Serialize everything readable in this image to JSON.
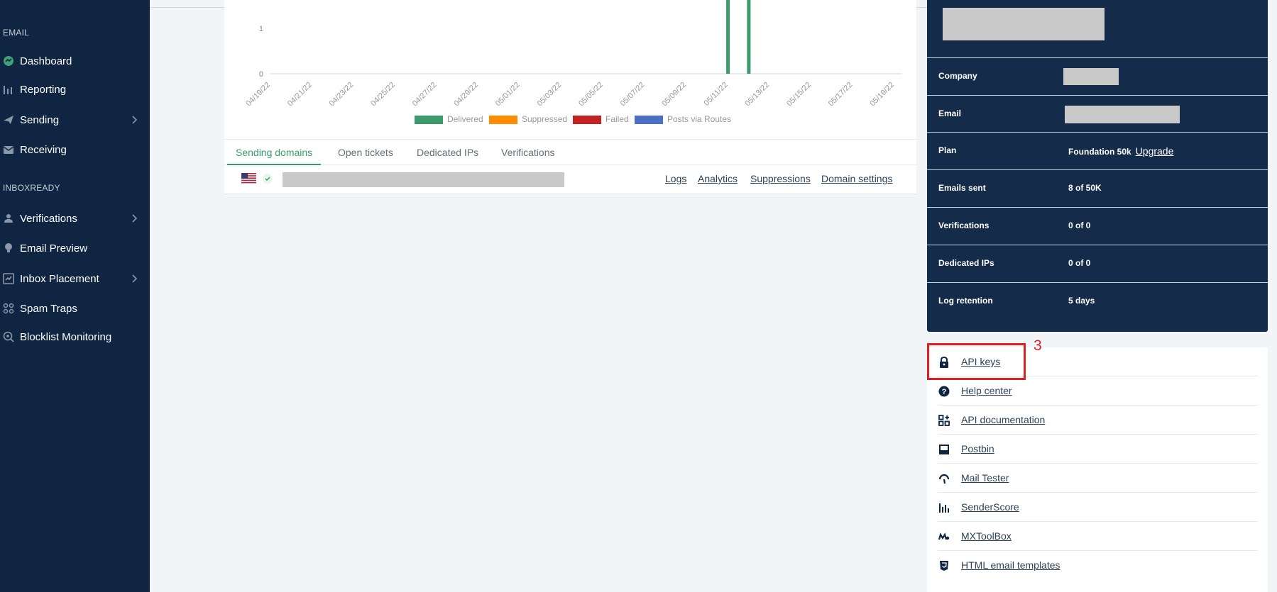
{
  "sidebar": {
    "section_email": "EMAIL",
    "section_inboxready": "INBOXREADY",
    "items": [
      {
        "label": "Dashboard",
        "icon": "dashboard-icon"
      },
      {
        "label": "Reporting",
        "icon": "bar-chart-icon"
      },
      {
        "label": "Sending",
        "icon": "paper-plane-icon"
      },
      {
        "label": "Receiving",
        "icon": "inbox-icon"
      },
      {
        "label": "Verifications",
        "icon": "user-check-icon"
      },
      {
        "label": "Email Preview",
        "icon": "lightbulb-icon"
      },
      {
        "label": "Inbox Placement",
        "icon": "placement-icon"
      },
      {
        "label": "Spam Traps",
        "icon": "trap-icon"
      },
      {
        "label": "Blocklist Monitoring",
        "icon": "monitor-icon"
      }
    ]
  },
  "chart_data": {
    "type": "bar",
    "x": [
      "04/19/22",
      "04/21/22",
      "04/23/22",
      "04/25/22",
      "04/27/22",
      "04/29/22",
      "05/01/22",
      "05/03/22",
      "05/05/22",
      "05/07/22",
      "05/09/22",
      "05/11/22",
      "05/13/22",
      "05/15/22",
      "05/17/22",
      "05/19/22"
    ],
    "y_ticks": [
      "0",
      "1"
    ],
    "series": [
      {
        "name": "Delivered",
        "color": "#3d9a6d",
        "points": [
          {
            "x": "05/11/22",
            "y": 2
          },
          {
            "x": "05/12/22",
            "y": 2
          }
        ]
      },
      {
        "name": "Suppressed",
        "color": "#ff8c00",
        "points": []
      },
      {
        "name": "Failed",
        "color": "#c62121",
        "points": []
      },
      {
        "name": "Posts via Routes",
        "color": "#4a6fc4",
        "points": []
      }
    ]
  },
  "tabs": [
    "Sending domains",
    "Open tickets",
    "Dedicated IPs",
    "Verifications"
  ],
  "domain_links": [
    "Logs",
    "Analytics",
    "Suppressions",
    "Domain settings"
  ],
  "account": {
    "rows": [
      {
        "label": "Company",
        "value": ""
      },
      {
        "label": "Email",
        "value": ""
      },
      {
        "label": "Plan",
        "value": "Foundation 50k",
        "action": "Upgrade"
      },
      {
        "label": "Emails sent",
        "value": "8 of 50K"
      },
      {
        "label": "Verifications",
        "value": "0 of 0"
      },
      {
        "label": "Dedicated IPs",
        "value": "0 of 0"
      },
      {
        "label": "Log retention",
        "value": "5 days"
      }
    ]
  },
  "links": [
    {
      "label": "API keys",
      "icon": "lock-icon"
    },
    {
      "label": "Help center",
      "icon": "question-circle-icon"
    },
    {
      "label": "API documentation",
      "icon": "grid-plus-icon"
    },
    {
      "label": "Postbin",
      "icon": "inbox-tray-icon"
    },
    {
      "label": "Mail Tester",
      "icon": "gauge-icon"
    },
    {
      "label": "SenderScore",
      "icon": "bars-icon"
    },
    {
      "label": "MXToolBox",
      "icon": "toolbox-icon"
    },
    {
      "label": "HTML email templates",
      "icon": "html5-icon"
    }
  ],
  "annotation": {
    "number": "3",
    "color": "#e02020"
  }
}
